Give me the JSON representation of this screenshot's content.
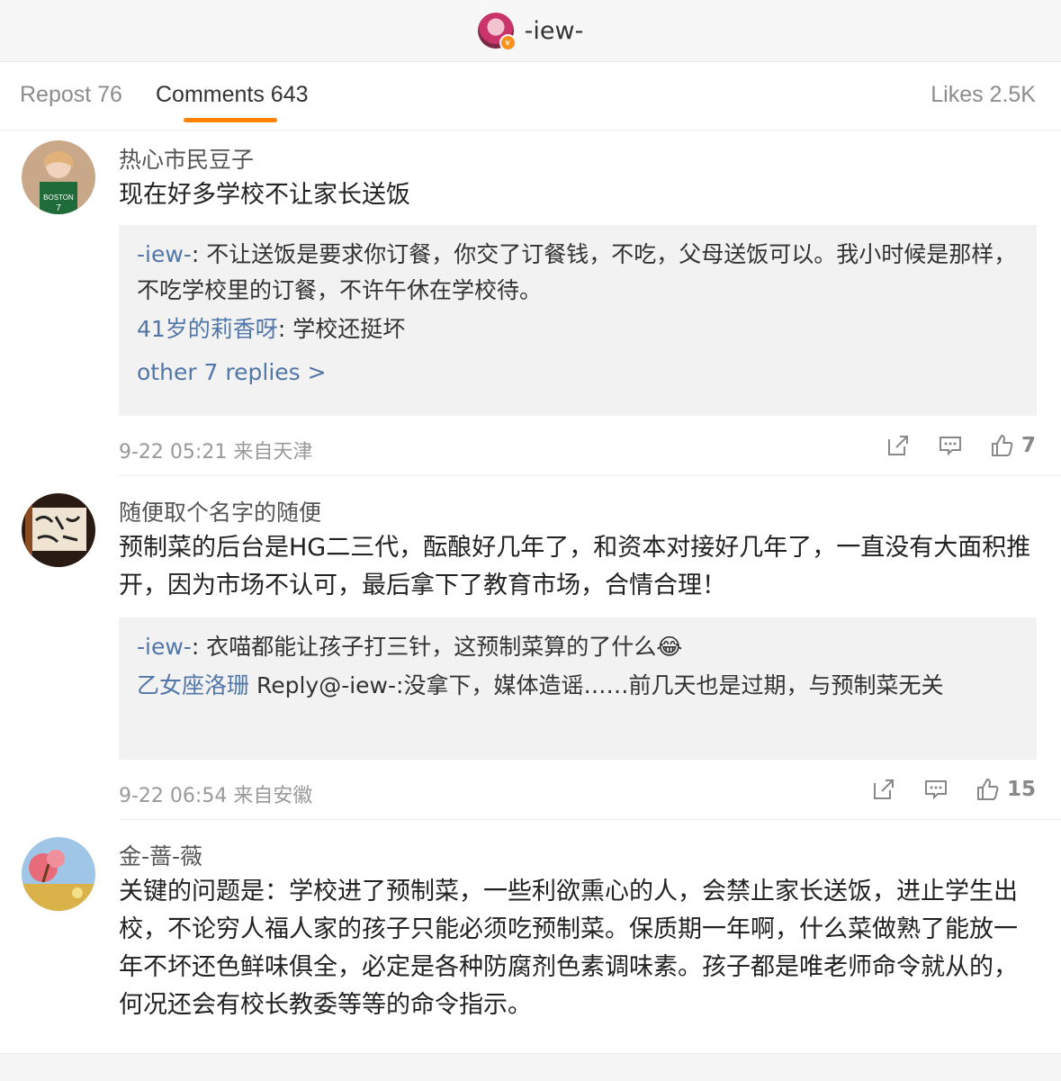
{
  "header": {
    "title": "-iew-",
    "verified_badge": "v"
  },
  "tabs": {
    "repost": "Repost 76",
    "comments": "Comments 643",
    "likes": "Likes 2.5K"
  },
  "colors": {
    "accent": "#ff8200",
    "link": "#5176a8",
    "reply_bg": "#f2f2f2"
  },
  "comments": [
    {
      "user": "热心市民豆子",
      "text": "现在好多学校不让家长送饭",
      "replies": [
        {
          "name": "-iew-",
          "sep": ": ",
          "text": "不让送饭是要求你订餐，你交了订餐钱，不吃，父母送饭可以。我小时候是那样，不吃学校里的订餐，不许午休在学校待。"
        },
        {
          "name": "41岁的莉香呀",
          "sep": ": ",
          "text": "学校还挺坏"
        }
      ],
      "more": "other 7 replies >",
      "meta": "9-22 05:21 来自天津",
      "likes": "7"
    },
    {
      "user": "随便取个名字的随便",
      "text": "预制菜的后台是HG二三代，酝酿好几年了，和资本对接好几年了，一直没有大面积推开，因为市场不认可，最后拿下了教育市场，合情合理！",
      "replies": [
        {
          "name": "-iew-",
          "sep": ": ",
          "text": "衣喵都能让孩子打三针，这预制菜算的了什么😂"
        },
        {
          "name": "乙女座洛珊",
          "sep": " ",
          "text": "Reply@-iew-:没拿下，媒体造谣……前几天也是过期，与预制菜无关"
        }
      ],
      "meta": "9-22 06:54 来自安徽",
      "likes": "15"
    },
    {
      "user": "金-蔷-薇",
      "text": "关键的问题是：学校进了预制菜，一些利欲熏心的人，会禁止家长送饭，进止学生出校，不论穷人福人家的孩子只能必须吃预制菜。保质期一年啊，什么菜做熟了能放一年不坏还色鲜味俱全，必定是各种防腐剂色素调味素。孩子都是唯老师命令就从的，何况还会有校长教委等等的命令指示。"
    }
  ]
}
